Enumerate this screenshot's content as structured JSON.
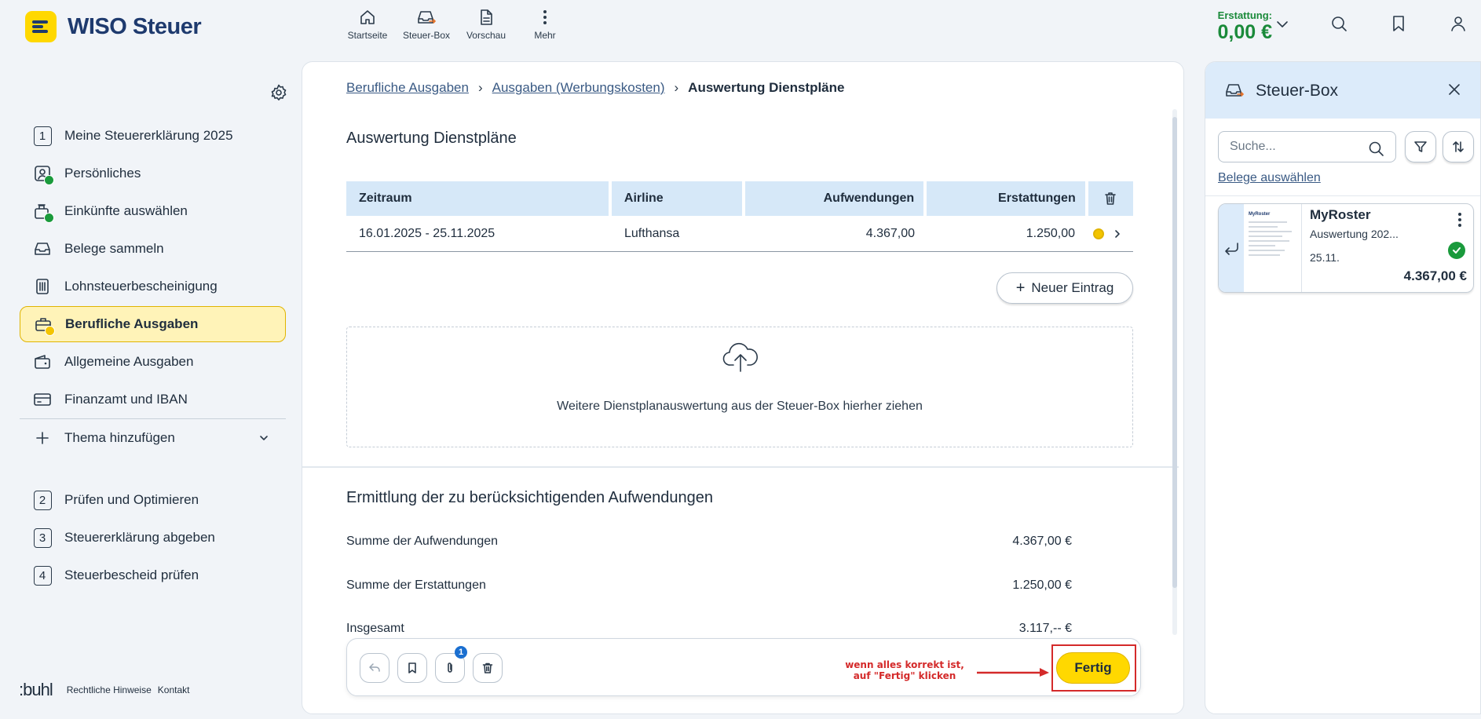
{
  "app": {
    "brand": "WISO Steuer"
  },
  "header": {
    "nav": [
      {
        "label": "Startseite",
        "icon": "home-icon"
      },
      {
        "label": "Steuer-Box",
        "icon": "inbox-upload-icon"
      },
      {
        "label": "Vorschau",
        "icon": "document-icon"
      },
      {
        "label": "Mehr",
        "icon": "more-vertical-icon"
      }
    ],
    "refund_label": "Erstattung:",
    "refund_value": "0,00 €"
  },
  "sidebar": {
    "items": [
      {
        "label": "Meine Steuererklärung 2025",
        "icon": "step-number",
        "number": "1"
      },
      {
        "label": "Persönliches",
        "icon": "person-icon"
      },
      {
        "label": "Einkünfte auswählen",
        "icon": "income-icon"
      },
      {
        "label": "Belege sammeln",
        "icon": "inbox-icon"
      },
      {
        "label": "Lohnsteuerbescheinigung",
        "icon": "wage-certificate-icon"
      },
      {
        "label": "Berufliche Ausgaben",
        "icon": "briefcase-icon",
        "active": true
      },
      {
        "label": "Allgemeine Ausgaben",
        "icon": "wallet-icon"
      },
      {
        "label": "Finanzamt und IBAN",
        "icon": "card-icon"
      },
      {
        "label": "Thema hinzufügen",
        "icon": "plus-icon"
      },
      {
        "label": "Prüfen und Optimieren",
        "number": "2"
      },
      {
        "label": "Steuererklärung abgeben",
        "number": "3"
      },
      {
        "label": "Steuerbescheid prüfen",
        "number": "4"
      }
    ],
    "footer": {
      "brand": ":buhl",
      "links": [
        "Rechtliche Hinweise",
        "Kontakt"
      ]
    }
  },
  "main": {
    "breadcrumb": [
      "Berufliche Ausgaben",
      "Ausgaben (Werbungskosten)",
      "Auswertung Dienstpläne"
    ],
    "title": "Auswertung Dienstpläne",
    "table": {
      "headers": [
        "Zeitraum",
        "Airline",
        "Aufwendungen",
        "Erstattungen"
      ],
      "rows": [
        {
          "zeitraum": "16.01.2025 - 25.11.2025",
          "airline": "Lufthansa",
          "aufwendungen": "4.367,00",
          "erstattungen": "1.250,00"
        }
      ]
    },
    "new_entry": "Neuer Eintrag",
    "dropzone_text": "Weitere Dienstplanauswertung aus der Steuer-Box hierher ziehen",
    "section_title": "Ermittlung der zu berücksichtigenden Aufwendungen",
    "sums": [
      {
        "label": "Summe der Aufwendungen",
        "value": "4.367,00 €"
      },
      {
        "label": "Summe der Erstattungen",
        "value": "1.250,00 €"
      },
      {
        "label": "Insgesamt",
        "value": "3.117,-- €"
      }
    ],
    "toolbar": {
      "attachment_count": "1",
      "note": "wenn alles korrekt ist, auf \"Fertig\" klicken",
      "done": "Fertig"
    }
  },
  "panel": {
    "title": "Steuer-Box",
    "search_placeholder": "Suche...",
    "select_docs": "Belege auswählen",
    "doc": {
      "name": "MyRoster",
      "subtitle": "Auswertung 202...",
      "date": "25.11.",
      "amount": "4.367,00 €",
      "thumb_title": "MyRoster"
    }
  },
  "colors": {
    "brand_yellow": "#ffd800",
    "brand_blue": "#1e3a6e",
    "success": "#1a9a3c",
    "annotation_red": "#d42a2a"
  }
}
